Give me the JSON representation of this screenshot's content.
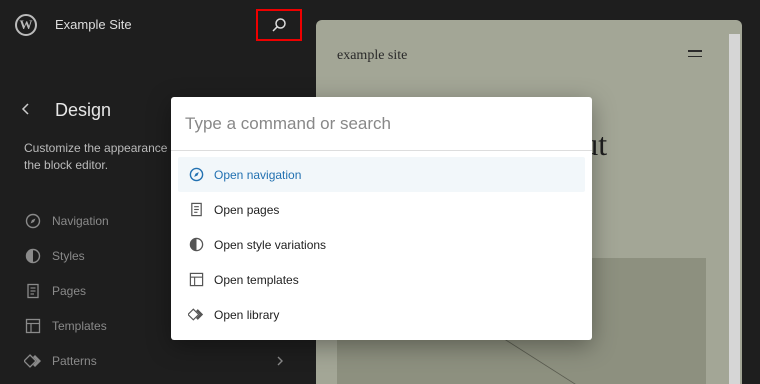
{
  "topbar": {
    "logo_glyph": "W",
    "site_name": "Example Site"
  },
  "sidebar": {
    "title": "Design",
    "description": "Customize the appearance of\nthe block editor.",
    "items": [
      {
        "label": "Navigation",
        "icon": "compass-icon"
      },
      {
        "label": "Styles",
        "icon": "half-circle-icon"
      },
      {
        "label": "Pages",
        "icon": "page-icon"
      },
      {
        "label": "Templates",
        "icon": "layout-icon"
      },
      {
        "label": "Patterns",
        "icon": "diamond-icon"
      }
    ]
  },
  "preview": {
    "site_title": "example site",
    "headline": "g about"
  },
  "command_palette": {
    "placeholder": "Type a command or search",
    "items": [
      {
        "label": "Open navigation",
        "icon": "compass-icon",
        "active": true
      },
      {
        "label": "Open pages",
        "icon": "page-icon",
        "active": false
      },
      {
        "label": "Open style variations",
        "icon": "half-circle-icon",
        "active": false
      },
      {
        "label": "Open templates",
        "icon": "layout-icon",
        "active": false
      },
      {
        "label": "Open library",
        "icon": "diamond-icon",
        "active": false
      }
    ]
  },
  "colors": {
    "accent": "#2271b1",
    "highlight_border": "#ee0000",
    "editor_background": "#1e1e1e",
    "preview_background": "#a3a696"
  }
}
